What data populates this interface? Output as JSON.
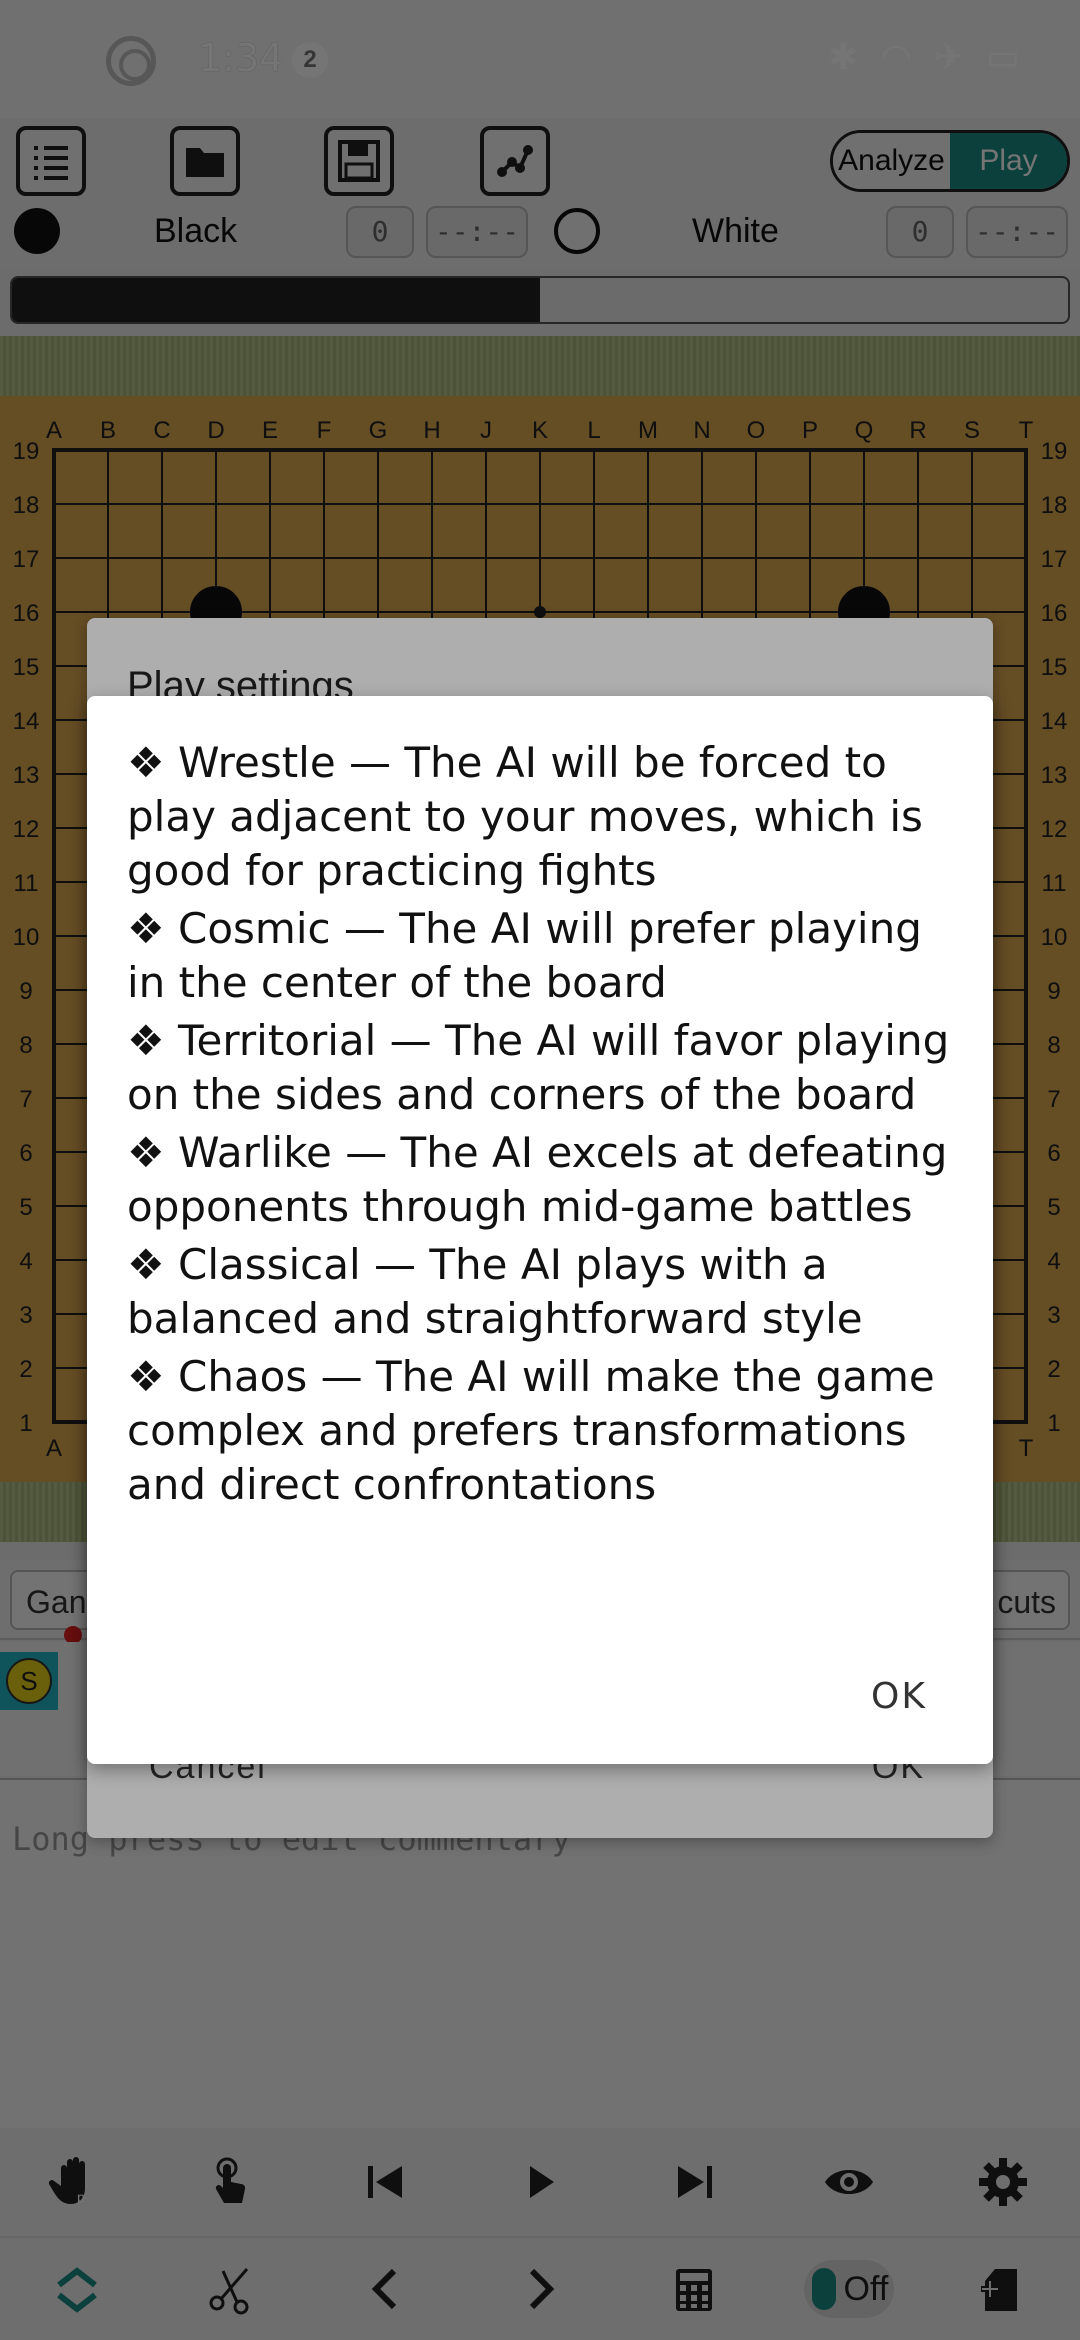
{
  "status_bar": {
    "time": "1:34",
    "notification_count": "2"
  },
  "toolbar": {
    "mode_analyze": "Analyze",
    "mode_play": "Play",
    "icons": [
      "list-icon",
      "folder-icon",
      "save-icon",
      "graph-icon"
    ]
  },
  "players": {
    "black_label": "Black",
    "black_captures": "0",
    "black_time": "--:--",
    "white_label": "White",
    "white_captures": "0",
    "white_time": "--:--"
  },
  "progress": {
    "fraction": 0.5
  },
  "board": {
    "columns": [
      "A",
      "B",
      "C",
      "D",
      "E",
      "F",
      "G",
      "H",
      "J",
      "K",
      "L",
      "M",
      "N",
      "O",
      "P",
      "Q",
      "R",
      "S",
      "T"
    ],
    "rows": [
      "19",
      "18",
      "17",
      "16",
      "15",
      "14",
      "13",
      "12",
      "11",
      "10",
      "9",
      "8",
      "7",
      "6",
      "5",
      "4",
      "3",
      "2",
      "1"
    ],
    "stones": [
      {
        "color": "black",
        "point": "D16"
      },
      {
        "color": "black",
        "point": "Q16"
      }
    ]
  },
  "lower_panel": {
    "tab_game": "Gan",
    "tab_shortcuts": "cuts",
    "tree_root": "S",
    "comment_placeholder": "Long press to edit commentary"
  },
  "bottom_nav": {
    "row1": [
      "hand-p-icon",
      "touch-icon",
      "skip-back-icon",
      "play-icon",
      "skip-forward-icon",
      "eye-icon",
      "gear-icon"
    ],
    "row2": [
      "collapse-icon",
      "scissors-icon",
      "prev-icon",
      "next-icon",
      "calculator-icon",
      "toggle",
      "add-file-icon"
    ],
    "toggle_label": "Off"
  },
  "back_dialog": {
    "title": "Play settings",
    "cancel": "Cancel",
    "ok": "OK"
  },
  "dialog": {
    "items": [
      "❖ Wrestle — The AI will be forced to play adjacent to your moves, which is good for practicing fights",
      "❖ Cosmic — The AI will prefer playing in the center of the board",
      "❖ Territorial — The AI will favor playing on the sides and corners of the board",
      "❖ Warlike — The AI excels at defeating opponents through mid-game battles",
      "❖ Classical — The AI plays with a balanced and straightforward style",
      "❖ Chaos — The AI will make the game complex and prefers transformations and direct confrontations"
    ],
    "ok": "OK"
  }
}
